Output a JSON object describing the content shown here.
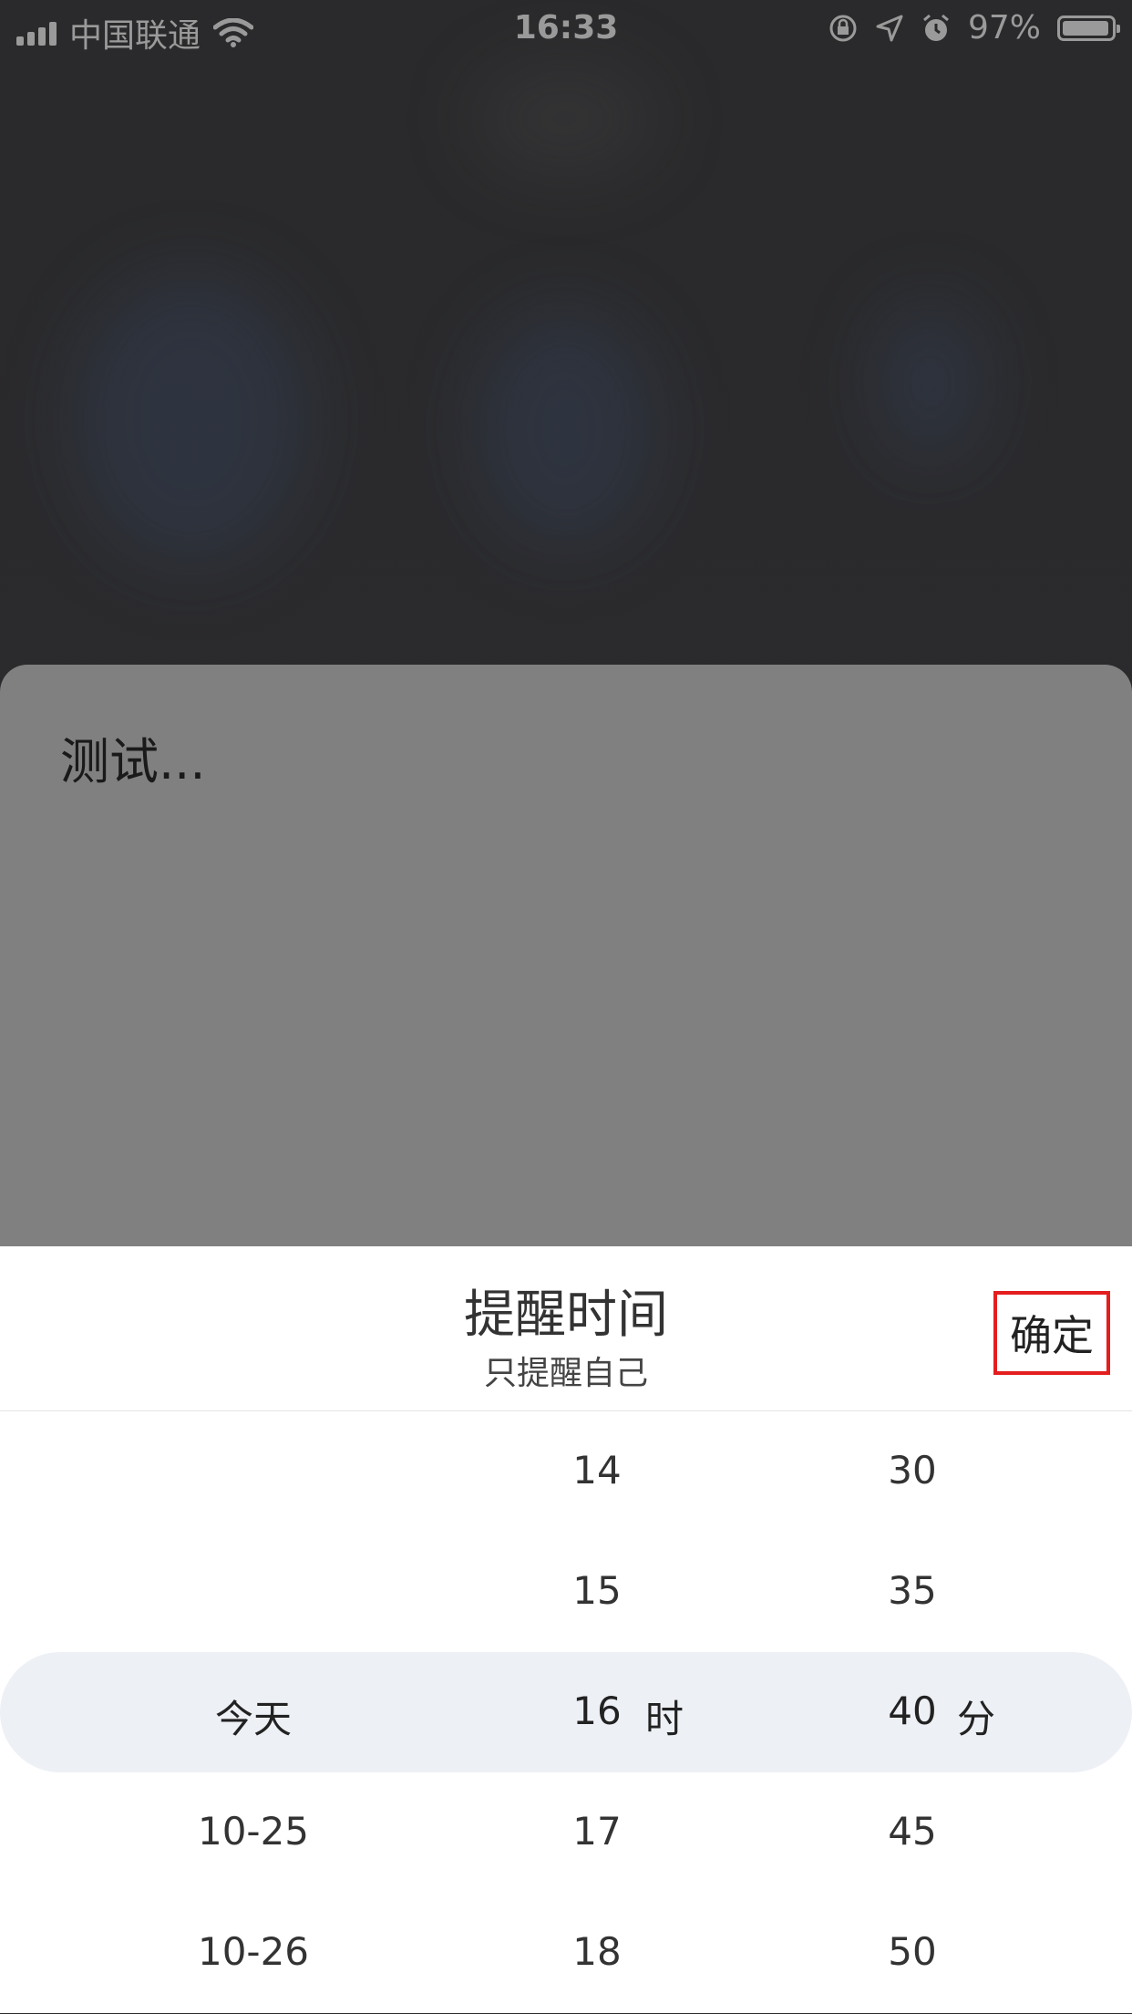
{
  "status_bar": {
    "carrier": "中国联通",
    "time": "16:33",
    "battery": "97%",
    "battery_level": 0.97
  },
  "note": {
    "text": "测试..."
  },
  "sheet": {
    "title": "提醒时间",
    "subtitle": "只提醒自己",
    "confirm_label": "确定"
  },
  "picker": {
    "date_column": [
      "",
      "",
      "今天",
      "10-25",
      "10-26"
    ],
    "hour_column": [
      "14",
      "15",
      "16",
      "17",
      "18"
    ],
    "minute_column": [
      "30",
      "35",
      "40",
      "45",
      "50"
    ],
    "hour_unit": "时",
    "minute_unit": "分",
    "selected_index": 2
  },
  "colors": {
    "confirm_border": "#e41e1e",
    "highlight": "#edf0f5"
  }
}
